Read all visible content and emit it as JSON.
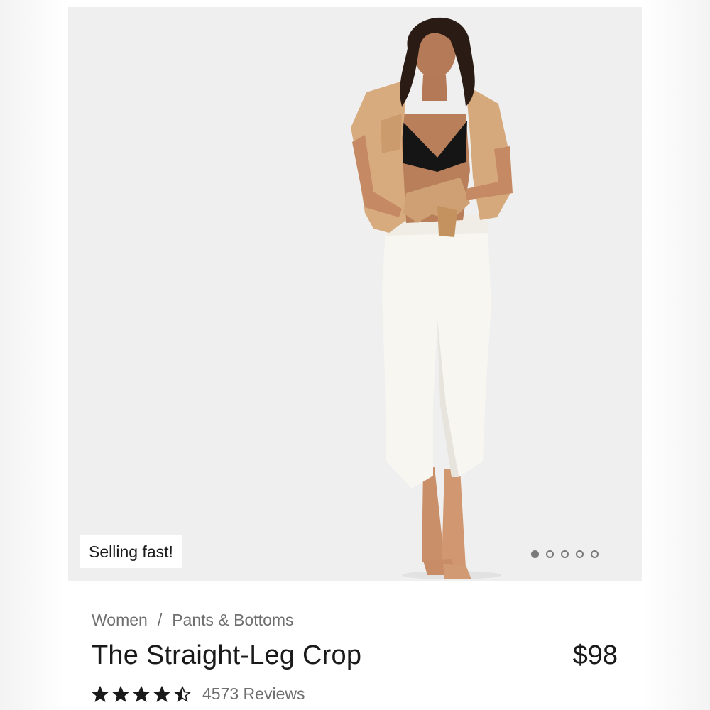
{
  "product": {
    "badge": "Selling fast!",
    "breadcrumb": {
      "category": "Women",
      "separator": "/",
      "subcategory": "Pants & Bottoms"
    },
    "title": "The Straight-Leg Crop",
    "price": "$98",
    "rating": {
      "value": 4.5,
      "max": 5,
      "reviews_label": "4573 Reviews"
    }
  },
  "gallery": {
    "image_count": 5,
    "active_index": 0
  },
  "colors": {
    "background": "#efefef",
    "text_primary": "#1a1a1a",
    "text_secondary": "#6f6f6f",
    "star": "#1a1a1a",
    "dot": "#7a7a7a"
  },
  "icons": {
    "rating": "star-icon",
    "pagination": "carousel-dot-icon"
  }
}
